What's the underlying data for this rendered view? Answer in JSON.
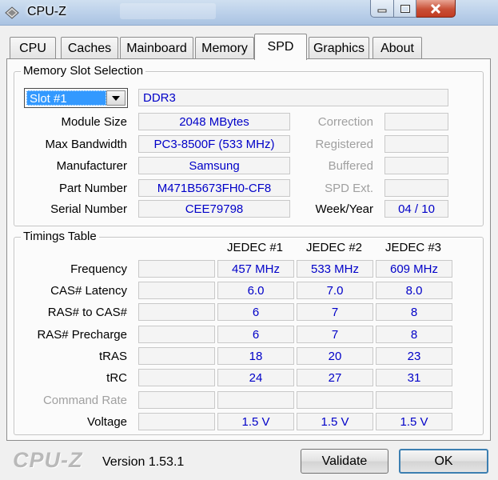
{
  "window": {
    "title": "CPU-Z"
  },
  "tabs": [
    {
      "label": "CPU"
    },
    {
      "label": "Caches"
    },
    {
      "label": "Mainboard"
    },
    {
      "label": "Memory"
    },
    {
      "label": "SPD"
    },
    {
      "label": "Graphics"
    },
    {
      "label": "About"
    }
  ],
  "active_tab": "SPD",
  "slot_section": {
    "title": "Memory Slot Selection",
    "slot_selected": "Slot #1",
    "memory_type": "DDR3",
    "module_size": {
      "label": "Module Size",
      "value": "2048 MBytes"
    },
    "max_bandwidth": {
      "label": "Max Bandwidth",
      "value": "PC3-8500F (533 MHz)"
    },
    "manufacturer": {
      "label": "Manufacturer",
      "value": "Samsung"
    },
    "part_number": {
      "label": "Part Number",
      "value": "M471B5673FH0-CF8"
    },
    "serial_number": {
      "label": "Serial Number",
      "value": "CEE79798"
    },
    "correction": {
      "label": "Correction",
      "value": ""
    },
    "registered": {
      "label": "Registered",
      "value": ""
    },
    "buffered": {
      "label": "Buffered",
      "value": ""
    },
    "spd_ext": {
      "label": "SPD Ext.",
      "value": ""
    },
    "week_year": {
      "label": "Week/Year",
      "value": "04 / 10"
    }
  },
  "timings": {
    "title": "Timings Table",
    "columns": [
      "",
      "JEDEC #1",
      "JEDEC #2",
      "JEDEC #3"
    ],
    "rows": [
      {
        "label": "Frequency",
        "values": [
          "",
          "457 MHz",
          "533 MHz",
          "609 MHz"
        ]
      },
      {
        "label": "CAS# Latency",
        "values": [
          "",
          "6.0",
          "7.0",
          "8.0"
        ]
      },
      {
        "label": "RAS# to CAS#",
        "values": [
          "",
          "6",
          "7",
          "8"
        ]
      },
      {
        "label": "RAS# Precharge",
        "values": [
          "",
          "6",
          "7",
          "8"
        ]
      },
      {
        "label": "tRAS",
        "values": [
          "",
          "18",
          "20",
          "23"
        ]
      },
      {
        "label": "tRC",
        "values": [
          "",
          "24",
          "27",
          "31"
        ]
      },
      {
        "label": "Command Rate",
        "values": [
          "",
          "",
          "",
          ""
        ]
      },
      {
        "label": "Voltage",
        "values": [
          "",
          "1.5 V",
          "1.5 V",
          "1.5 V"
        ]
      }
    ]
  },
  "footer": {
    "logo": "CPU-Z",
    "version": "Version 1.53.1",
    "validate_label": "Validate",
    "ok_label": "OK"
  }
}
